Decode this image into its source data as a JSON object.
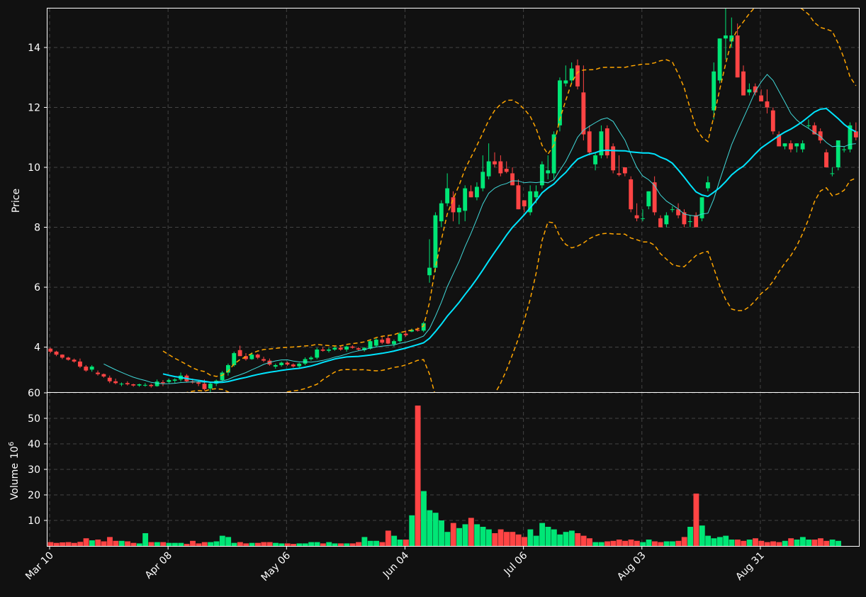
{
  "chart_data": [
    {
      "type": "candlestick",
      "panel": "price",
      "ylabel": "Price",
      "ylim": [
        2.5,
        15.3
      ],
      "yticks": [
        4,
        6,
        8,
        10,
        12,
        14
      ],
      "xtick_labels": [
        "Mar 10",
        "Apr 08",
        "May 06",
        "Jun 04",
        "Jul 06",
        "Aug 03",
        "Aug 31"
      ],
      "grid": true,
      "up_color": "#00e676",
      "down_color": "#ff4444",
      "ohlc": [
        [
          3.95,
          3.98,
          3.8,
          3.85
        ],
        [
          3.85,
          3.88,
          3.7,
          3.75
        ],
        [
          3.75,
          3.76,
          3.6,
          3.65
        ],
        [
          3.65,
          3.68,
          3.55,
          3.58
        ],
        [
          3.58,
          3.62,
          3.48,
          3.52
        ],
        [
          3.52,
          3.62,
          3.3,
          3.35
        ],
        [
          3.35,
          3.4,
          3.18,
          3.22
        ],
        [
          3.25,
          3.4,
          3.18,
          3.35
        ],
        [
          3.15,
          3.22,
          3.05,
          3.1
        ],
        [
          3.1,
          3.12,
          2.98,
          3.02
        ],
        [
          2.98,
          3.05,
          2.8,
          2.86
        ],
        [
          2.86,
          2.95,
          2.76,
          2.8
        ],
        [
          2.76,
          2.82,
          2.7,
          2.78
        ],
        [
          2.8,
          2.86,
          2.72,
          2.76
        ],
        [
          2.76,
          2.78,
          2.68,
          2.72
        ],
        [
          2.72,
          2.78,
          2.68,
          2.76
        ],
        [
          2.72,
          2.8,
          2.68,
          2.74
        ],
        [
          2.74,
          2.78,
          2.65,
          2.7
        ],
        [
          2.7,
          2.92,
          2.68,
          2.85
        ],
        [
          2.83,
          2.9,
          2.7,
          2.8
        ],
        [
          2.84,
          2.95,
          2.78,
          2.9
        ],
        [
          2.88,
          2.96,
          2.8,
          2.92
        ],
        [
          2.92,
          3.15,
          2.85,
          3.05
        ],
        [
          3.05,
          3.1,
          2.82,
          2.86
        ],
        [
          2.86,
          2.95,
          2.78,
          2.82
        ],
        [
          2.82,
          2.88,
          2.7,
          2.78
        ],
        [
          2.78,
          2.92,
          2.55,
          2.6
        ],
        [
          2.62,
          2.82,
          2.5,
          2.78
        ],
        [
          2.78,
          2.92,
          2.7,
          2.88
        ],
        [
          2.9,
          3.2,
          2.85,
          3.15
        ],
        [
          3.15,
          3.45,
          3.05,
          3.4
        ],
        [
          3.4,
          3.85,
          3.35,
          3.8
        ],
        [
          3.9,
          4.05,
          3.75,
          3.7
        ],
        [
          3.7,
          3.8,
          3.55,
          3.6
        ],
        [
          3.6,
          3.82,
          3.58,
          3.75
        ],
        [
          3.75,
          3.78,
          3.6,
          3.65
        ],
        [
          3.6,
          3.68,
          3.5,
          3.55
        ],
        [
          3.55,
          3.62,
          3.38,
          3.42
        ],
        [
          3.35,
          3.45,
          3.28,
          3.4
        ],
        [
          3.4,
          3.52,
          3.35,
          3.48
        ],
        [
          3.48,
          3.52,
          3.38,
          3.42
        ],
        [
          3.42,
          3.46,
          3.32,
          3.36
        ],
        [
          3.36,
          3.48,
          3.3,
          3.45
        ],
        [
          3.45,
          3.66,
          3.4,
          3.6
        ],
        [
          3.6,
          3.7,
          3.55,
          3.65
        ],
        [
          3.65,
          3.98,
          3.6,
          3.92
        ],
        [
          3.92,
          4.0,
          3.85,
          3.88
        ],
        [
          3.88,
          3.98,
          3.82,
          3.92
        ],
        [
          3.92,
          4.05,
          3.88,
          3.98
        ],
        [
          3.98,
          4.06,
          3.88,
          3.92
        ],
        [
          3.92,
          4.05,
          3.85,
          4.02
        ],
        [
          4.02,
          4.06,
          3.95,
          3.98
        ],
        [
          3.96,
          4.0,
          3.88,
          3.92
        ],
        [
          3.9,
          4.0,
          3.85,
          3.98
        ],
        [
          3.95,
          4.25,
          3.92,
          4.2
        ],
        [
          4.05,
          4.3,
          4.0,
          4.25
        ],
        [
          4.25,
          4.38,
          4.1,
          4.15
        ],
        [
          4.3,
          4.38,
          4.1,
          4.12
        ],
        [
          4.1,
          4.25,
          4.02,
          4.2
        ],
        [
          4.2,
          4.5,
          4.15,
          4.45
        ],
        [
          4.45,
          4.55,
          4.35,
          4.4
        ],
        [
          4.52,
          4.62,
          4.5,
          4.58
        ],
        [
          4.58,
          4.66,
          4.52,
          4.55
        ],
        [
          4.55,
          4.85,
          4.5,
          4.8
        ],
        [
          6.4,
          7.6,
          6.15,
          6.65
        ],
        [
          6.65,
          8.5,
          6.5,
          8.4
        ],
        [
          8.2,
          8.9,
          8.0,
          8.8
        ],
        [
          8.8,
          9.8,
          8.7,
          9.3
        ],
        [
          9.0,
          9.2,
          8.2,
          8.5
        ],
        [
          8.5,
          8.75,
          8.1,
          8.65
        ],
        [
          8.55,
          9.4,
          8.2,
          9.3
        ],
        [
          9.2,
          9.4,
          9.0,
          9.0
        ],
        [
          9.0,
          9.5,
          8.9,
          9.35
        ],
        [
          9.3,
          10.4,
          9.2,
          9.85
        ],
        [
          9.7,
          10.8,
          9.6,
          10.2
        ],
        [
          10.2,
          10.5,
          10.0,
          10.1
        ],
        [
          10.2,
          10.4,
          9.7,
          9.8
        ],
        [
          9.95,
          10.2,
          9.8,
          9.85
        ],
        [
          9.8,
          10.0,
          9.4,
          9.4
        ],
        [
          9.4,
          9.6,
          8.6,
          8.6
        ],
        [
          8.9,
          8.9,
          8.5,
          8.7
        ],
        [
          8.5,
          9.4,
          8.4,
          9.2
        ],
        [
          9.0,
          9.4,
          8.8,
          9.2
        ],
        [
          9.4,
          10.2,
          9.3,
          10.1
        ],
        [
          9.8,
          10.4,
          9.6,
          9.9
        ],
        [
          9.8,
          11.2,
          9.6,
          11.1
        ],
        [
          11.4,
          13.0,
          11.2,
          12.9
        ],
        [
          12.8,
          13.4,
          12.7,
          12.9
        ],
        [
          12.9,
          13.5,
          12.8,
          13.3
        ],
        [
          13.4,
          13.6,
          12.6,
          12.7
        ],
        [
          12.5,
          13.4,
          10.9,
          11.1
        ],
        [
          11.2,
          11.4,
          10.4,
          10.5
        ],
        [
          10.1,
          10.5,
          9.9,
          10.4
        ],
        [
          10.4,
          11.4,
          10.3,
          11.2
        ],
        [
          11.3,
          11.4,
          10.3,
          10.4
        ],
        [
          10.7,
          10.8,
          9.8,
          9.9
        ],
        [
          9.8,
          10.4,
          9.7,
          9.75
        ],
        [
          10.0,
          10.0,
          9.7,
          9.8
        ],
        [
          9.6,
          9.7,
          8.5,
          8.6
        ],
        [
          8.4,
          8.8,
          8.2,
          8.3
        ],
        [
          8.3,
          8.6,
          8.2,
          8.3
        ],
        [
          8.7,
          9.2,
          8.6,
          9.2
        ],
        [
          9.5,
          9.7,
          8.4,
          8.5
        ],
        [
          8.3,
          8.4,
          8.0,
          8.0
        ],
        [
          8.1,
          8.5,
          8.0,
          8.4
        ],
        [
          8.6,
          8.7,
          8.5,
          8.6
        ],
        [
          8.6,
          8.8,
          8.3,
          8.4
        ],
        [
          8.5,
          8.6,
          8.0,
          8.1
        ],
        [
          8.2,
          8.4,
          8.0,
          8.2
        ],
        [
          8.4,
          8.5,
          8.0,
          8.0
        ],
        [
          8.3,
          9.0,
          8.2,
          9.0
        ],
        [
          9.3,
          9.7,
          9.2,
          9.5
        ],
        [
          11.9,
          13.5,
          11.6,
          13.2
        ],
        [
          12.9,
          14.3,
          12.8,
          14.3
        ],
        [
          14.3,
          15.3,
          13.6,
          14.4
        ],
        [
          14.2,
          15.0,
          14.0,
          14.4
        ],
        [
          14.4,
          14.8,
          13.0,
          13.0
        ],
        [
          13.2,
          13.4,
          12.6,
          12.4
        ],
        [
          12.5,
          12.8,
          12.4,
          12.6
        ],
        [
          12.7,
          12.8,
          12.4,
          12.5
        ],
        [
          12.4,
          12.6,
          12.2,
          12.2
        ],
        [
          12.2,
          12.6,
          11.8,
          12.0
        ],
        [
          11.9,
          12.0,
          11.1,
          11.2
        ],
        [
          11.1,
          11.2,
          10.7,
          10.7
        ],
        [
          10.7,
          10.8,
          10.6,
          10.8
        ],
        [
          10.8,
          10.9,
          10.5,
          10.6
        ],
        [
          10.7,
          10.8,
          10.5,
          10.8
        ],
        [
          10.6,
          10.9,
          10.5,
          10.8
        ],
        [
          11.4,
          11.6,
          11.3,
          11.4
        ],
        [
          11.4,
          11.5,
          11.1,
          11.1
        ],
        [
          11.2,
          11.3,
          10.8,
          10.9
        ],
        [
          10.5,
          10.6,
          10.0,
          10.0
        ],
        [
          9.8,
          10.0,
          9.7,
          9.8
        ],
        [
          10.0,
          10.9,
          9.9,
          10.9
        ],
        [
          10.6,
          10.7,
          10.5,
          10.6
        ],
        [
          10.6,
          11.5,
          10.5,
          11.4
        ],
        [
          11.2,
          11.5,
          10.9,
          11.0
        ]
      ],
      "lines": [
        {
          "color": "#40d8d8",
          "width": 1,
          "values": [
            null,
            null,
            null,
            null,
            null,
            null,
            null,
            null,
            null,
            null,
            null,
            null,
            null,
            null,
            null,
            null,
            null,
            null,
            null,
            null,
            null,
            null,
            null,
            null,
            null,
            null,
            null,
            null,
            null,
            null,
            null,
            null,
            null,
            null,
            null,
            null,
            null,
            null,
            null,
            null,
            null,
            null,
            null,
            null,
            null,
            null,
            null,
            null,
            null,
            null,
            null,
            null,
            null,
            null,
            null,
            null,
            null,
            null,
            null,
            null,
            null,
            null,
            null,
            null,
            null,
            null,
            null,
            null,
            null,
            null,
            null,
            null,
            null,
            null,
            null,
            null,
            null,
            null,
            null,
            null,
            null,
            null,
            null,
            null,
            null,
            null,
            null,
            null,
            null,
            null,
            null,
            null,
            null,
            null,
            null,
            null,
            null,
            null,
            null,
            null,
            null,
            null,
            null,
            null,
            null,
            null,
            null,
            null,
            null,
            null,
            null,
            null,
            null,
            null,
            null,
            null,
            null,
            null,
            null,
            null,
            null,
            null,
            null,
            null,
            null,
            null,
            null,
            null,
            null,
            null,
            null,
            null,
            null,
            null,
            null,
            null,
            null,
            null,
            null,
            null,
            null,
            null,
            null
          ]
        },
        {
          "color": "#00e5ff",
          "width": 2,
          "values": []
        },
        {
          "color": "#ffa500",
          "width": 1.5,
          "dash": "6,4",
          "values": []
        },
        {
          "color": "#ffa500",
          "width": 1.5,
          "dash": "6,4",
          "values": []
        }
      ]
    },
    {
      "type": "bar",
      "panel": "volume",
      "ylabel": "Volume",
      "ylabel_exponent": "10",
      "ylabel_power": "6",
      "ylim": [
        0,
        60
      ],
      "yticks": [
        10,
        20,
        30,
        40,
        50,
        60
      ],
      "grid": true,
      "values": [
        1.5,
        1.2,
        1.4,
        1.5,
        1.2,
        1.6,
        3.0,
        2.2,
        2.5,
        1.8,
        3.5,
        2.0,
        2.0,
        1.8,
        1.2,
        1.0,
        5.0,
        1.5,
        1.5,
        1.5,
        1.2,
        1.2,
        1.2,
        0.8,
        2.0,
        1.0,
        1.5,
        1.5,
        1.8,
        4.0,
        3.5,
        1.2,
        1.5,
        1.0,
        1.2,
        1.2,
        1.5,
        1.5,
        1.2,
        1.0,
        1.0,
        0.8,
        1.0,
        1.0,
        1.5,
        1.5,
        1.0,
        1.5,
        1.0,
        1.0,
        1.0,
        1.0,
        1.5,
        3.5,
        2.0,
        2.0,
        1.5,
        6.0,
        4.0,
        2.5,
        2.5,
        12.0,
        55.0,
        21.5,
        14.0,
        13.0,
        10.0,
        5.5,
        9.0,
        7.0,
        8.5,
        11.0,
        8.5,
        7.5,
        6.5,
        5.0,
        6.5,
        5.5,
        5.5,
        4.5,
        3.5,
        6.5,
        4.0,
        9.0,
        7.5,
        6.5,
        4.5,
        5.5,
        6.0,
        5.0,
        4.0,
        3.0,
        1.5,
        1.5,
        1.8,
        2.0,
        2.5,
        2.0,
        2.5,
        2.0,
        1.5,
        2.5,
        1.8,
        1.5,
        1.8,
        1.8,
        2.0,
        3.5,
        7.5,
        20.5,
        8.0,
        4.0,
        3.0,
        3.5,
        4.0,
        2.5,
        2.5,
        2.0,
        2.5,
        3.0,
        2.0,
        1.5,
        1.8,
        1.5,
        2.0,
        3.0,
        2.5,
        3.5,
        2.5,
        2.5,
        3.0,
        2.0,
        2.5,
        2.0
      ]
    }
  ]
}
